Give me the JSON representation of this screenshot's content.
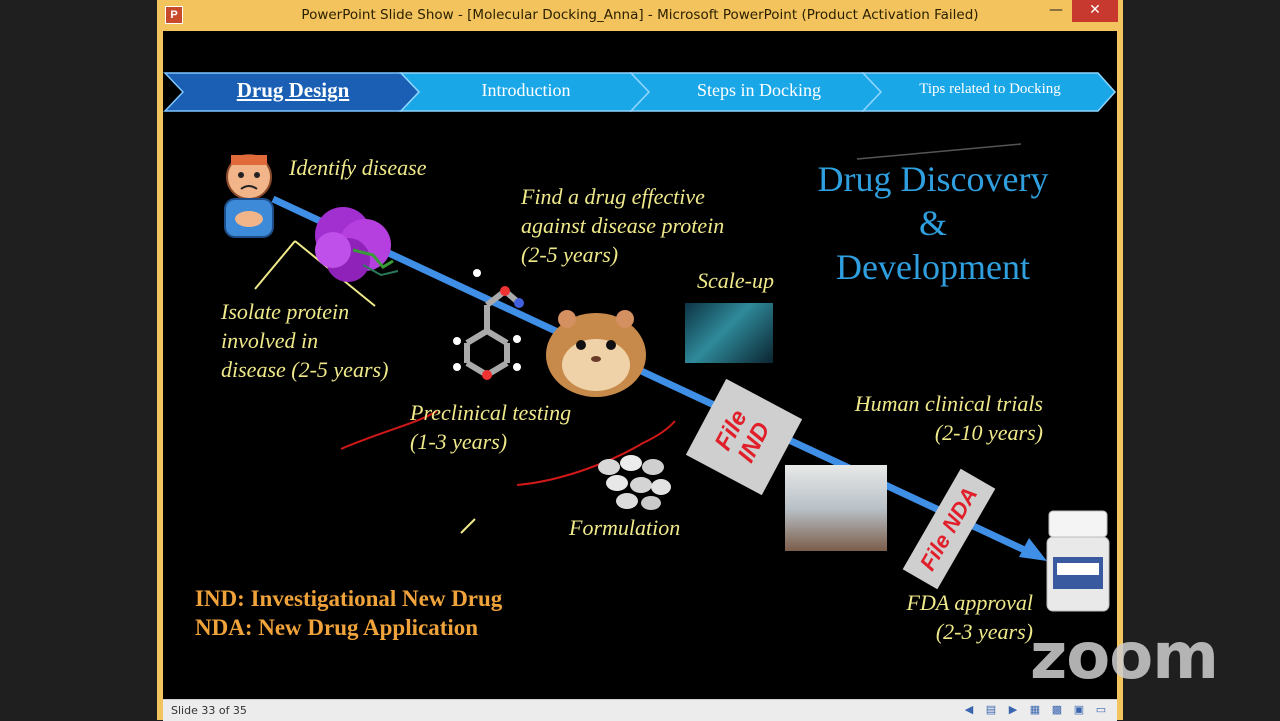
{
  "window": {
    "title": "PowerPoint Slide Show - [Molecular Docking_Anna] - Microsoft PowerPoint (Product Activation Failed)",
    "app_icon_letter": "P",
    "min_glyph": "—",
    "max_glyph": "▭",
    "close_glyph": "✕"
  },
  "nav": {
    "items": [
      {
        "label": "Drug Design",
        "active": true
      },
      {
        "label": "Introduction",
        "active": false
      },
      {
        "label": "Steps in Docking",
        "active": false
      },
      {
        "label": "Tips related to Docking",
        "active": false
      }
    ],
    "active_color": "#1a5fb4",
    "inactive_color": "#1aa7e8"
  },
  "slide": {
    "heading": {
      "line1": "Drug Discovery",
      "line2": "&",
      "line3": "Development"
    },
    "labels": {
      "identify_disease": "Identify disease",
      "find_drug": [
        "Find a drug effective",
        "against disease protein",
        "(2-5 years)"
      ],
      "scale_up": "Scale-up",
      "isolate_protein": [
        "Isolate protein",
        "involved in",
        "disease (2-5 years)"
      ],
      "preclinical": [
        "Preclinical testing",
        "(1-3 years)"
      ],
      "human_trials": [
        "Human clinical trials",
        "(2-10 years)"
      ],
      "formulation": "Formulation",
      "fda_approval": [
        "FDA approval",
        "(2-3 years)"
      ]
    },
    "file_ind": [
      "File",
      "IND"
    ],
    "file_nda": "File NDA",
    "legend": [
      "IND: Investigational New Drug",
      "NDA: New Drug Application"
    ]
  },
  "status": {
    "slide_counter": "Slide 33 of 35"
  },
  "overlay": {
    "zoom_logo": "zoom"
  },
  "colors": {
    "arrow": "#3f8fe6",
    "label_yellow": "#f0e98a",
    "legend_orange": "#f0a33a",
    "heading_blue": "#2f9fdf",
    "file_red": "#e01f2a",
    "pen_red": "#d01818"
  }
}
